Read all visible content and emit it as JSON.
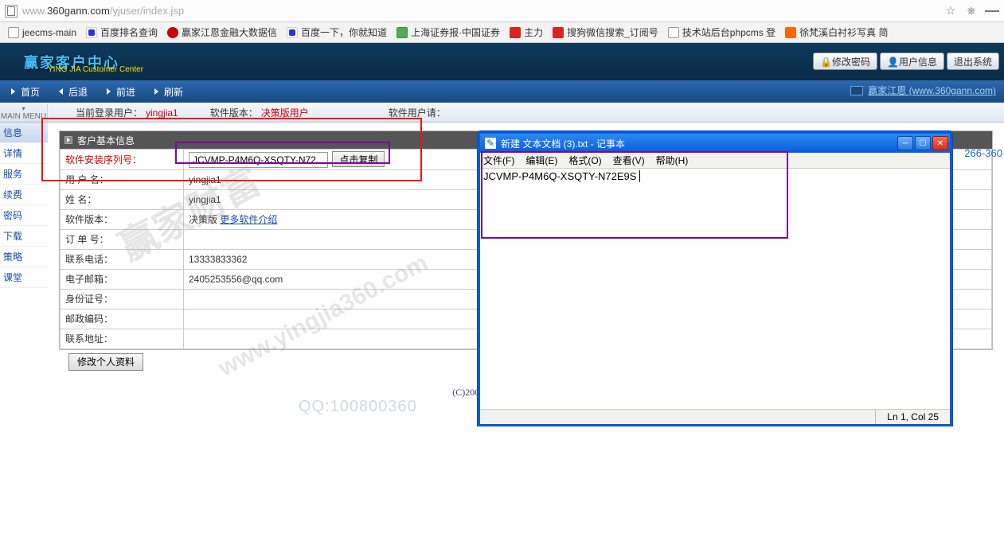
{
  "browser": {
    "url_gray": "www.",
    "url_host": "360gann.com",
    "url_path": "/yjuser/index.jsp"
  },
  "bookmarks": [
    {
      "fav": "doc",
      "label": "jeecms-main"
    },
    {
      "fav": "baidu",
      "label": "百度排名查询"
    },
    {
      "fav": "red",
      "label": "赢家江恩金融大数据信"
    },
    {
      "fav": "baidu",
      "label": "百度一下，你就知道"
    },
    {
      "fav": "purple",
      "label": "上海证券报·中国证券"
    },
    {
      "fav": "redc",
      "label": "主力"
    },
    {
      "fav": "redc",
      "label": "搜狗微信搜索_订阅号"
    },
    {
      "fav": "doc",
      "label": "技术站后台phpcms 登"
    },
    {
      "fav": "orange",
      "label": "徐梵溪白衬衫写真 简"
    }
  ],
  "header": {
    "logo": "赢家客户中心",
    "logo_sub": "YING JIA Customer Center",
    "btn_pwd": "修改密码",
    "btn_userinfo": "用户信息",
    "btn_logout": "退出系统"
  },
  "nav": {
    "home": "首页",
    "back": "后退",
    "forward": "前进",
    "refresh": "刷新",
    "right_text": "赢家江恩 (www.360gann.com)"
  },
  "main_menu_label": "MAIN MENU",
  "crumb": {
    "login_lbl": "当前登录用户：",
    "login_val": "yingjia1",
    "ver_lbl": "软件版本：",
    "ver_val": "决策版用户",
    "tip_lbl": "软件用户请："
  },
  "sidebar": [
    "信息",
    "详情",
    "服务",
    "续费",
    "密码",
    "下载",
    "策略",
    "课堂"
  ],
  "panel_title": "客户基本信息",
  "rows": {
    "serial_lbl": "软件安装序列号：",
    "serial_val": "JCVMP-P4M6Q-XSQTY-N72",
    "copy_btn": "点击复制",
    "user_lbl": "用 户 名：",
    "user_val": "yingjia1",
    "name_lbl": "姓    名：",
    "name_val": "yingjia1",
    "ver_lbl": "软件版本：",
    "ver_val": "决策版",
    "ver_link": "更多软件介绍",
    "order_lbl": "订 单 号：",
    "phone_lbl": "联系电话：",
    "phone_val": "13333833362",
    "email_lbl": "电子邮箱：",
    "email_val": "2405253556@qq.com",
    "id_lbl": "身份证号：",
    "zip_lbl": "邮政编码：",
    "addr_lbl": "联系地址："
  },
  "edit_btn": "修改个人资料",
  "footer": "(C)2004-2013 YingJia. All rights reser",
  "phone_partial": "266-360",
  "watermark1": "赢家财富",
  "watermark2": "www.yingjia360.com",
  "qq_wm": "QQ:100800360",
  "notepad": {
    "title": "新建 文本文档 (3).txt - 记事本",
    "menu_file": "文件(F)",
    "menu_edit": "编辑(E)",
    "menu_format": "格式(O)",
    "menu_view": "查看(V)",
    "menu_help": "帮助(H)",
    "content": "JCVMP-P4M6Q-XSQTY-N72E9S",
    "status": "Ln 1, Col 25"
  }
}
